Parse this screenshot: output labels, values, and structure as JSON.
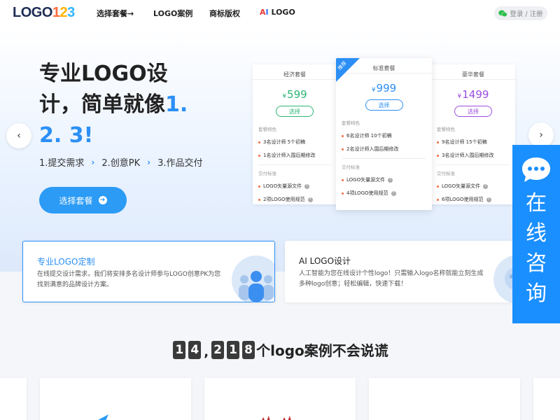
{
  "nav": {
    "logo_text": "LOGO",
    "logo_digits": [
      "1",
      "2",
      "3"
    ],
    "items": [
      {
        "label": "选择套餐→"
      },
      {
        "label": "LOGO案例"
      },
      {
        "label": "商标版权"
      }
    ],
    "ai_logo": {
      "a": "A",
      "i": "I",
      "label": "LOGO"
    },
    "login_label": "登录 / 注册"
  },
  "hero": {
    "headline_main": "专业LOGO设计，简单就像",
    "headline_highlight": "1. 2. 3!",
    "steps": [
      "1.提交需求",
      "2.创意PK",
      "3.作品交付"
    ],
    "cta_label": "选择套餐",
    "prev_icon": "‹",
    "next_icon": "›"
  },
  "pricing": [
    {
      "title": "经济套餐",
      "currency": "¥",
      "price": "599",
      "select_label": "选择",
      "feature_heading": "套餐特色",
      "features": [
        "3名设计师 5个初稿",
        "1名设计师入围后期修改"
      ],
      "delivery_heading": "交付标准",
      "deliveries": [
        "LOGO矢量源文件",
        "2项LOGO使用规范"
      ],
      "accent": "#2bb673"
    },
    {
      "title": "标准套餐",
      "currency": "¥",
      "price": "999",
      "select_label": "选择",
      "badge": "推荐",
      "feature_heading": "套餐特色",
      "features": [
        "6名设计师 10个初稿",
        "2名设计师入围后期修改"
      ],
      "delivery_heading": "交付标准",
      "deliveries": [
        "LOGO矢量源文件",
        "4项LOGO使用规范"
      ],
      "accent": "#2b8ff5"
    },
    {
      "title": "豪华套餐",
      "currency": "¥",
      "price": "1499",
      "select_label": "选择",
      "feature_heading": "套餐特色",
      "features": [
        "9名设计师 15个初稿",
        "3名设计师入围后期修改"
      ],
      "delivery_heading": "交付标准",
      "deliveries": [
        "LOGO矢量源文件",
        "6项LOGO使用规范"
      ],
      "accent": "#9b4de0"
    }
  ],
  "features": [
    {
      "title": "专业LOGO定制",
      "desc": "在线提交设计需求，我们将安排多名设计师参与LOGO创意PK为您找到满意的品牌设计方案。",
      "title_color": "#2b8ff5"
    },
    {
      "title": "AI LOGO设计",
      "desc": "人工智能为您在线设计个性logo！只需输入logo名称就能立刻生成多种logo创意；轻松编辑，快速下载！",
      "title_color": "#222222"
    }
  ],
  "chat": {
    "chars": [
      "在",
      "线",
      "咨",
      "询"
    ]
  },
  "cases": {
    "digits_a": [
      "1",
      "4"
    ],
    "comma": ",",
    "digits_b": [
      "2",
      "1",
      "8"
    ],
    "suffix": "个logo案例不会说谎"
  },
  "colors": {
    "accent": "#2b8ff5",
    "chat_bg": "#1a8fff",
    "cta_bg": "#2b9bf5"
  }
}
